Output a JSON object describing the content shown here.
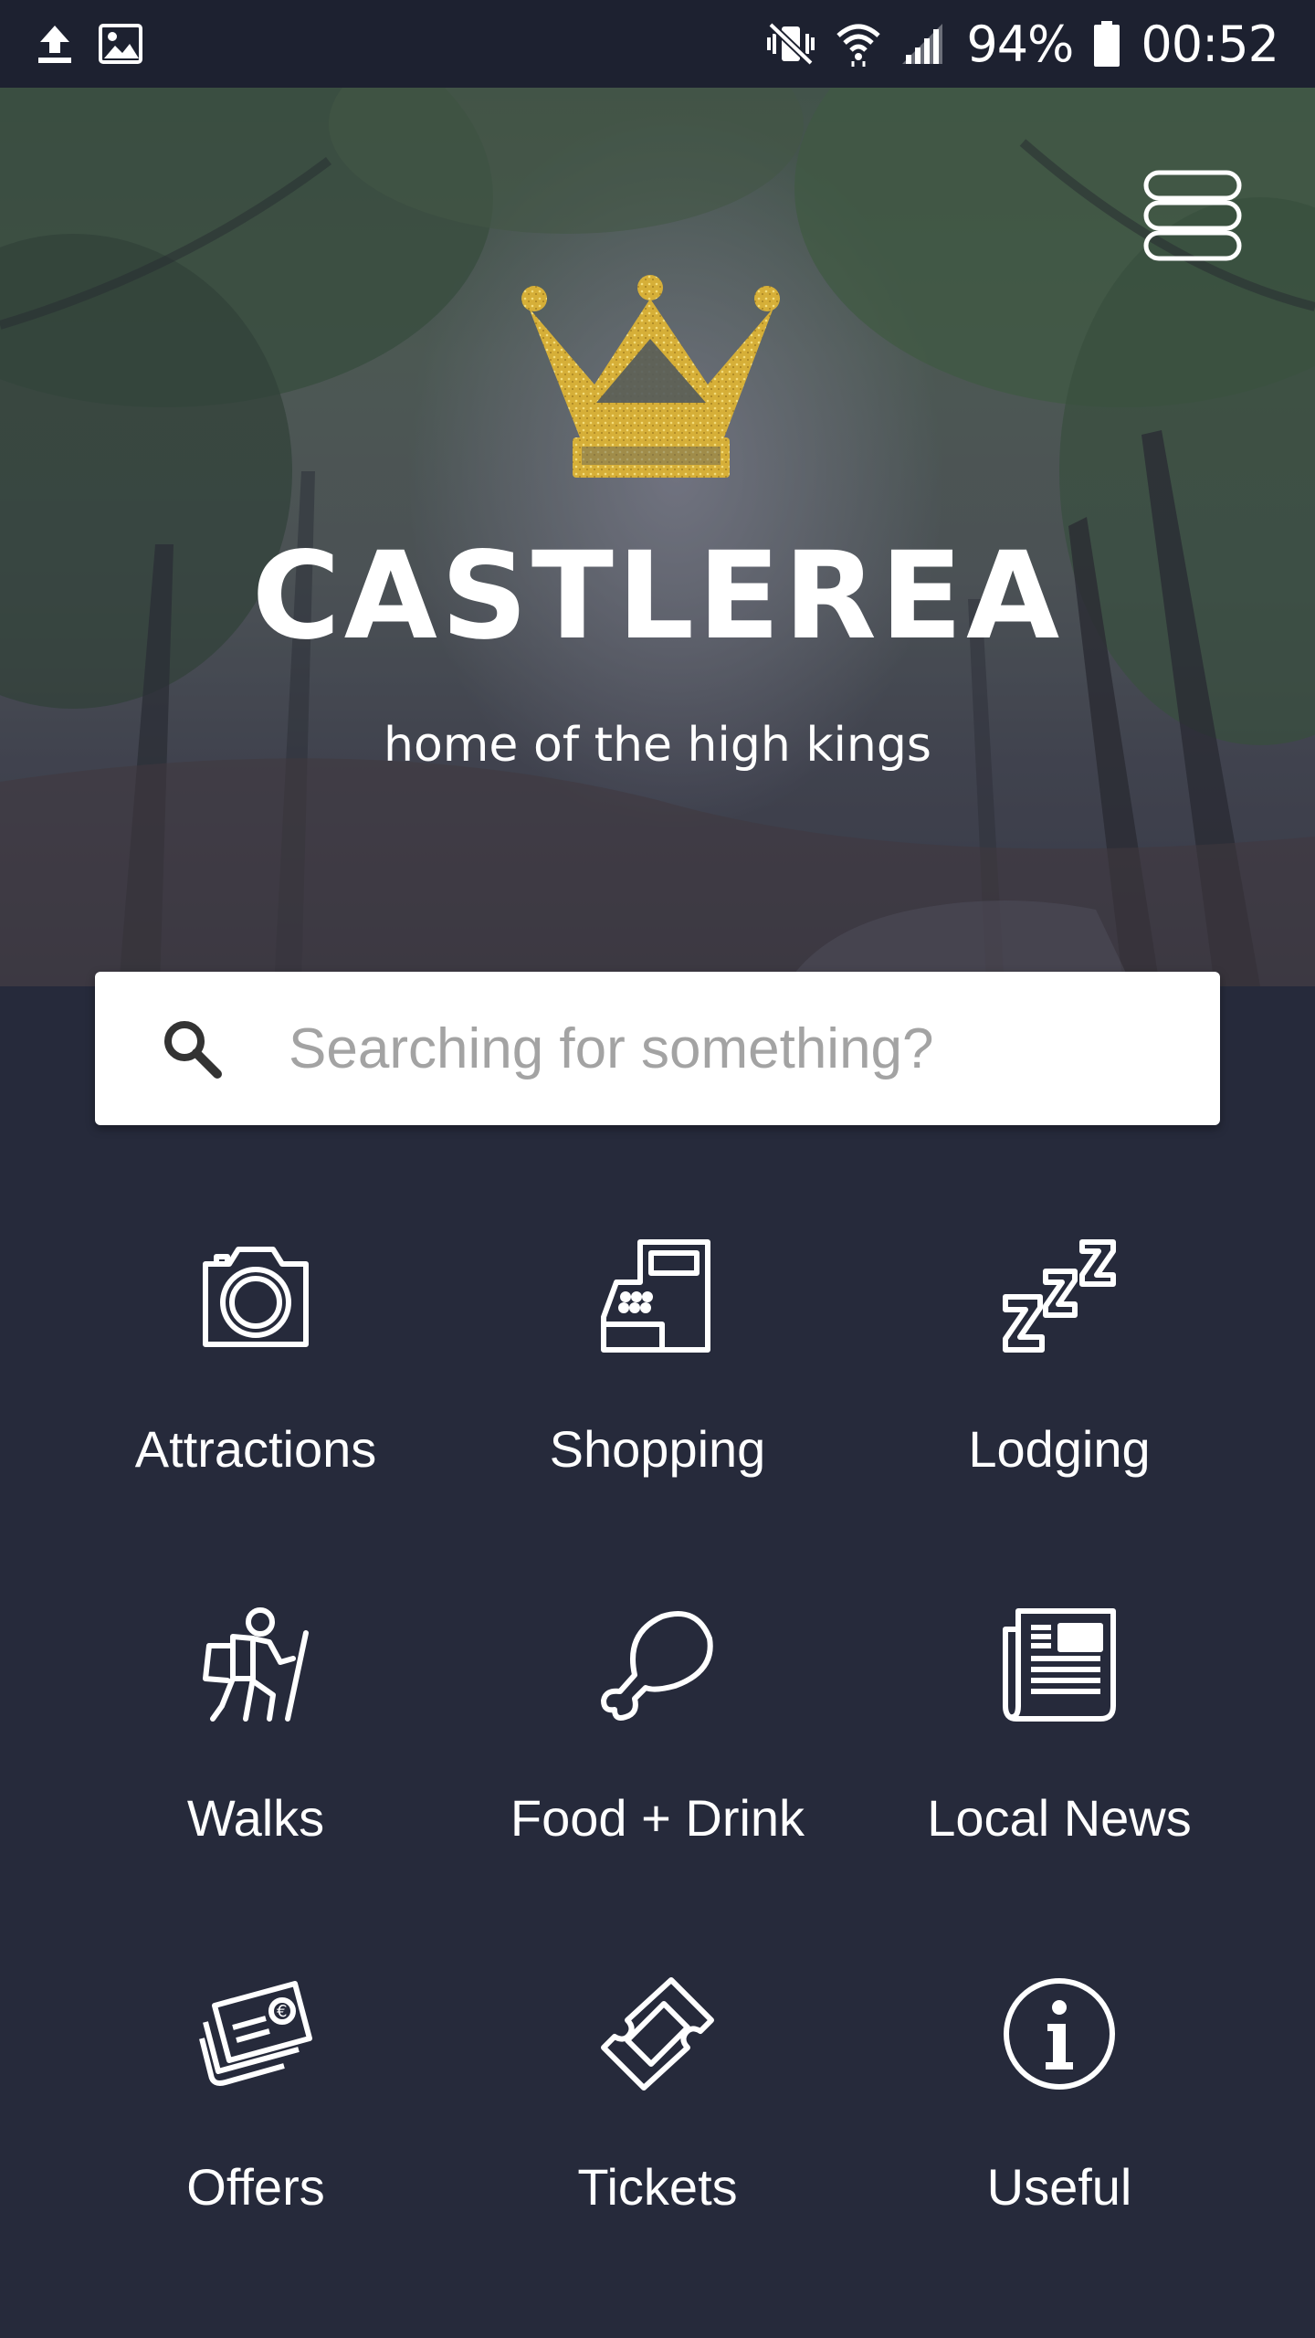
{
  "status_bar": {
    "battery": "94%",
    "time": "00:52",
    "icons": [
      "upload-icon",
      "image-icon",
      "vibrate-mute-icon",
      "wifi-icon",
      "signal-icon",
      "battery-icon"
    ]
  },
  "hero": {
    "title": "CASTLEREA",
    "tagline": "home of the high kings",
    "logo_icon": "crown-icon",
    "menu_icon": "menu-icon"
  },
  "search": {
    "placeholder": "Searching for something?",
    "value": "",
    "icon": "search-icon"
  },
  "categories": [
    {
      "label": "Attractions",
      "icon": "camera-icon"
    },
    {
      "label": "Shopping",
      "icon": "cash-register-icon"
    },
    {
      "label": "Lodging",
      "icon": "sleep-zzz-icon"
    },
    {
      "label": "Walks",
      "icon": "hiker-icon"
    },
    {
      "label": "Food + Drink",
      "icon": "chicken-leg-icon"
    },
    {
      "label": "Local News",
      "icon": "newspaper-icon"
    },
    {
      "label": "Offers",
      "icon": "euro-ticket-icon"
    },
    {
      "label": "Tickets",
      "icon": "ticket-icon"
    },
    {
      "label": "Useful",
      "icon": "info-icon"
    }
  ],
  "colors": {
    "background": "#262a3b",
    "status_bar": "#1d2130",
    "crown_gold": "#d8b23a",
    "text": "#ffffff"
  }
}
